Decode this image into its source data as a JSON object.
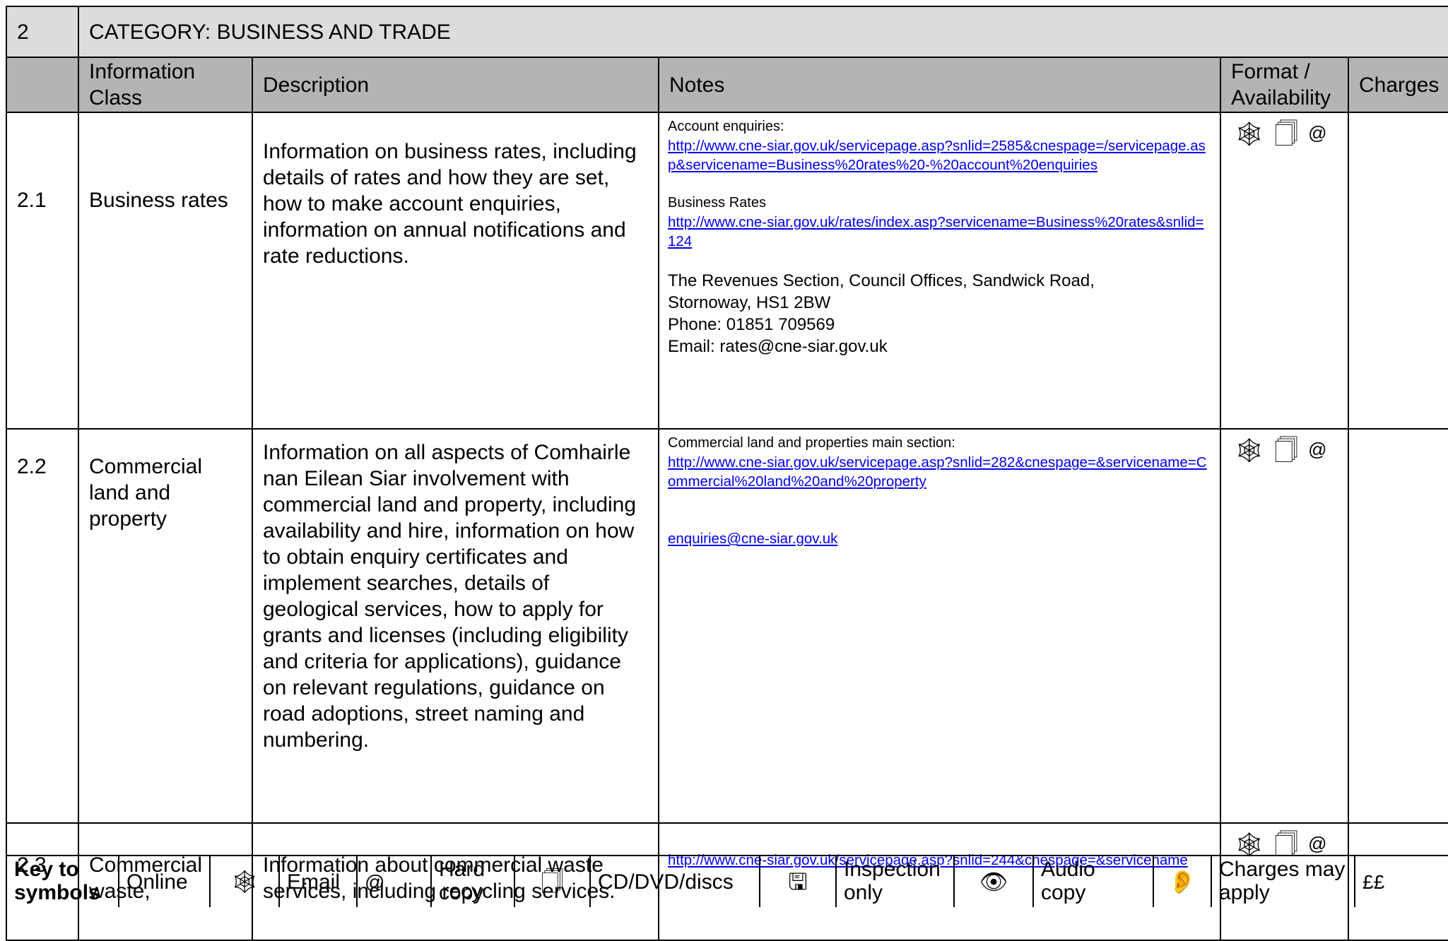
{
  "category": {
    "number": "2",
    "title": "CATEGORY: BUSINESS AND TRADE"
  },
  "headers": {
    "info_class": "Information Class",
    "description": "Description",
    "notes": "Notes",
    "format": "Format / Availability",
    "charges": "Charges"
  },
  "rows": [
    {
      "num": "2.1",
      "info_class": "Business rates",
      "description": "Information on business rates, including details of rates and how they are set, how to make account enquiries, information on annual notifications and rate reductions.",
      "notes": {
        "label_1": "Account enquiries:",
        "link_1": "http://www.cne-siar.gov.uk/servicepage.asp?snlid=2585&cnespage=/servicepage.asp&servicename=Business%20rates%20-%20account%20enquiries",
        "label_2": "Business Rates",
        "link_2": "http://www.cne-siar.gov.uk/rates/index.asp?servicename=Business%20rates&snlid=124",
        "address_1": "The Revenues Section, Council Offices, Sandwick Road,",
        "address_2": "Stornoway, HS1 2BW",
        "phone": "Phone: 01851 709569",
        "email": "Email: rates@cne-siar.gov.uk"
      },
      "format_symbols": [
        "online-icon",
        "hard-copy-icon",
        "email-icon"
      ],
      "charges": ""
    },
    {
      "num": "2.2",
      "info_class": "Commercial land and property",
      "description": "Information on all aspects of Comhairle nan Eilean Siar involvement with commercial land and property, including availability and hire, information on how to obtain enquiry certificates and implement searches, details of geological services, how to apply for grants and licenses (including eligibility and criteria for applications), guidance on relevant regulations, guidance on road adoptions, street naming and numbering.",
      "notes": {
        "label_1": "Commercial land and properties main section:",
        "link_1": "http://www.cne-siar.gov.uk/servicepage.asp?snlid=282&cnespage=&servicename=Commercial%20land%20and%20property",
        "email_link": "enquiries@cne-siar.gov.uk"
      },
      "format_symbols": [
        "online-icon",
        "hard-copy-icon",
        "email-icon"
      ],
      "charges": ""
    },
    {
      "num": "2.3",
      "info_class": "Commercial waste,",
      "description": "Information about commercial waste services, including recycling services.",
      "notes": {
        "link_1": "http://www.cne-siar.gov.uk/servicepage.asp?snlid=244&cnespage=&servicename"
      },
      "format_symbols": [
        "online-icon",
        "hard-copy-icon",
        "email-icon"
      ],
      "charges": ""
    }
  ],
  "key": {
    "heading": "Key to symbols",
    "items": [
      {
        "label": "Online",
        "symbol": "online-icon"
      },
      {
        "label": "Email",
        "symbol": "email-icon"
      },
      {
        "label": "Hard copy",
        "symbol": "hard-copy-icon"
      },
      {
        "label": "CD/DVD/discs",
        "symbol": "disc-icon"
      },
      {
        "label": "Inspection only",
        "symbol": "eye-icon"
      },
      {
        "label": "Audio copy",
        "symbol": "ear-icon"
      },
      {
        "label": "Charges may apply",
        "symbol": "££"
      }
    ]
  }
}
